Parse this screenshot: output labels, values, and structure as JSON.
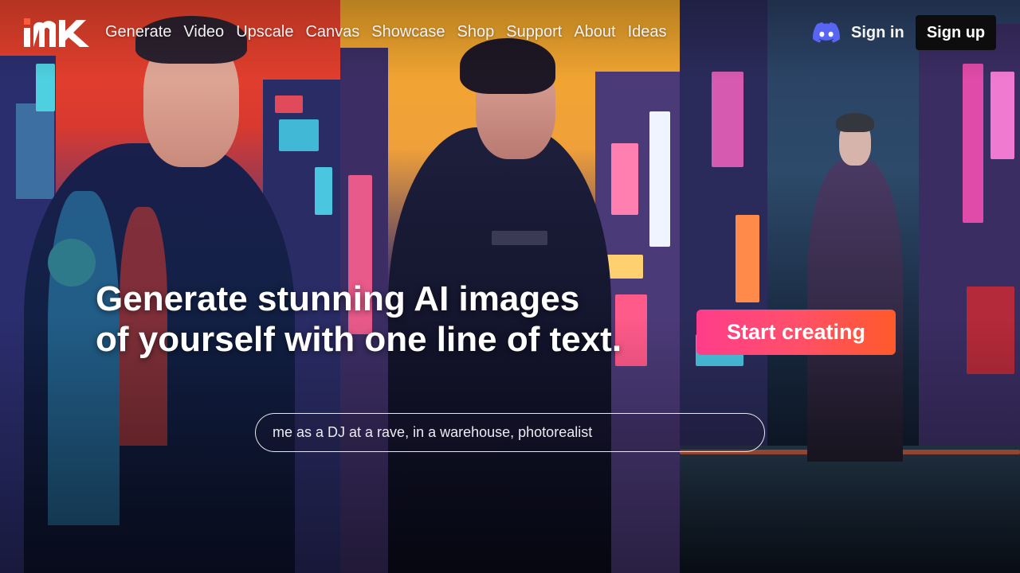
{
  "brand": {
    "logo_icon": "imagine-me-logo"
  },
  "nav": {
    "links": [
      "Generate",
      "Video",
      "Upscale",
      "Canvas",
      "Showcase",
      "Shop",
      "Support",
      "About",
      "Ideas"
    ],
    "discord_icon": "discord-icon",
    "signin_label": "Sign in",
    "signup_label": "Sign up"
  },
  "hero": {
    "headline_line1": "Generate stunning AI images",
    "headline_line2": "of yourself with one line of text.",
    "cta_label": "Start creating",
    "prompt_placeholder": "me as a DJ at a rave, in a warehouse, photorealist"
  },
  "colors": {
    "cta_gradient_start": "#ff3d8b",
    "cta_gradient_end": "#ff5a2a",
    "signup_bg": "#0d0d0d",
    "discord_blue": "#5865f2"
  }
}
